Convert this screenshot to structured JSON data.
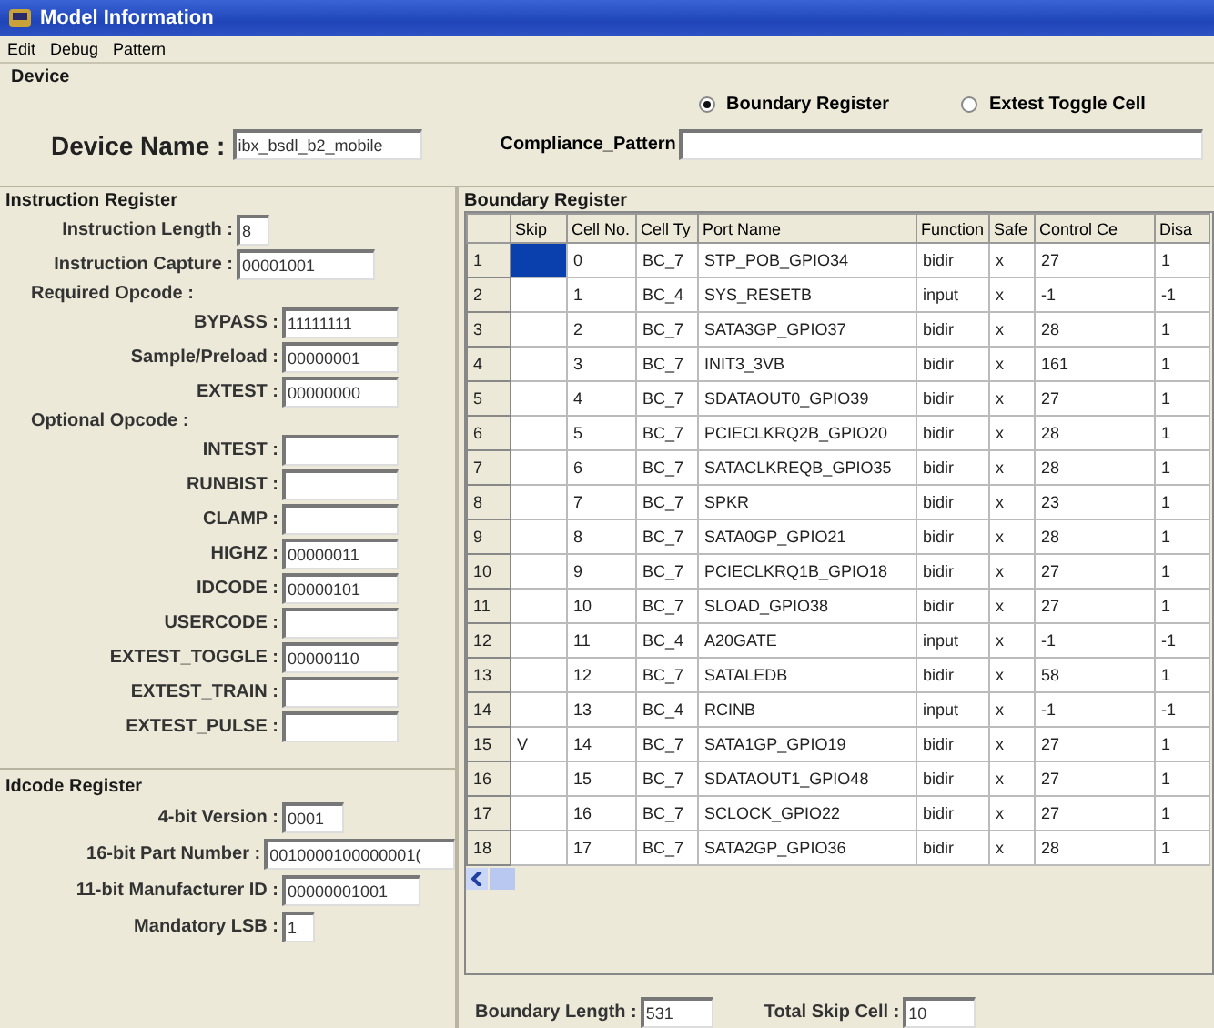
{
  "window": {
    "title": "Model Information"
  },
  "menu": [
    "Edit",
    "Debug",
    "Pattern"
  ],
  "device": {
    "title": "Device",
    "radios": [
      {
        "label": "Boundary Register",
        "selected": true
      },
      {
        "label": "Extest Toggle Cell",
        "selected": false
      }
    ],
    "name_label": "Device Name :",
    "name_value": "ibx_bsdl_b2_mobile",
    "pattern_label": "Compliance_Pattern"
  },
  "instruction_register": {
    "title": "Instruction Register",
    "items": [
      {
        "kind": "field",
        "label": "Instruction Length :",
        "value": "8"
      },
      {
        "kind": "field",
        "label": "Instruction Capture :",
        "value": "00001001"
      },
      {
        "kind": "heading",
        "label": "Required Opcode :"
      },
      {
        "kind": "opcode",
        "label": "BYPASS :",
        "value": "11111111"
      },
      {
        "kind": "opcode",
        "label": "Sample/Preload :",
        "value": "00000001"
      },
      {
        "kind": "opcode",
        "label": "EXTEST :",
        "value": "00000000"
      },
      {
        "kind": "heading",
        "label": "Optional Opcode :"
      },
      {
        "kind": "opcode",
        "label": "INTEST :"
      },
      {
        "kind": "opcode",
        "label": "RUNBIST :"
      },
      {
        "kind": "opcode",
        "label": "CLAMP :"
      },
      {
        "kind": "opcode",
        "label": "HIGHZ :",
        "value": "00000011"
      },
      {
        "kind": "opcode",
        "label": "IDCODE :",
        "value": "00000101"
      },
      {
        "kind": "opcode",
        "label": "USERCODE :"
      },
      {
        "kind": "opcode",
        "label": "EXTEST_TOGGLE :",
        "value": "00000110"
      },
      {
        "kind": "opcode",
        "label": "EXTEST_TRAIN :"
      },
      {
        "kind": "opcode",
        "label": "EXTEST_PULSE :"
      }
    ]
  },
  "idcode_register": {
    "title": "Idcode Register",
    "items": [
      {
        "label": "4-bit Version :",
        "value": "0001"
      },
      {
        "label": "16-bit Part Number :",
        "value": "0010000100000001("
      },
      {
        "label": "11-bit Manufacturer ID :",
        "value": "00000001001"
      },
      {
        "label": "Mandatory LSB :",
        "value": "1"
      }
    ]
  },
  "boundary_register": {
    "title": "Boundary Register",
    "columns": [
      "Skip",
      "Cell No.",
      "Cell Ty",
      "Port Name",
      "Function",
      "Safe",
      "Control Ce",
      "Disa"
    ],
    "rows": [
      {
        "header": "1",
        "selected": true,
        "cells": [
          "",
          "0",
          "BC_7",
          "STP_POB_GPIO34",
          "bidir",
          "x",
          "27",
          "1"
        ]
      },
      {
        "header": "2",
        "selected": false,
        "cells": [
          "",
          "1",
          "BC_4",
          "SYS_RESETB",
          "input",
          "x",
          "-1",
          "-1"
        ]
      },
      {
        "header": "3",
        "selected": false,
        "cells": [
          "",
          "2",
          "BC_7",
          "SATA3GP_GPIO37",
          "bidir",
          "x",
          "28",
          "1"
        ]
      },
      {
        "header": "4",
        "selected": false,
        "cells": [
          "",
          "3",
          "BC_7",
          "INIT3_3VB",
          "bidir",
          "x",
          "161",
          "1"
        ]
      },
      {
        "header": "5",
        "selected": false,
        "cells": [
          "",
          "4",
          "BC_7",
          "SDATAOUT0_GPIO39",
          "bidir",
          "x",
          "27",
          "1"
        ]
      },
      {
        "header": "6",
        "selected": false,
        "cells": [
          "",
          "5",
          "BC_7",
          "PCIECLKRQ2B_GPIO20",
          "bidir",
          "x",
          "28",
          "1"
        ]
      },
      {
        "header": "7",
        "selected": false,
        "cells": [
          "",
          "6",
          "BC_7",
          "SATACLKREQB_GPIO35",
          "bidir",
          "x",
          "28",
          "1"
        ]
      },
      {
        "header": "8",
        "selected": false,
        "cells": [
          "",
          "7",
          "BC_7",
          "SPKR",
          "bidir",
          "x",
          "23",
          "1"
        ]
      },
      {
        "header": "9",
        "selected": false,
        "cells": [
          "",
          "8",
          "BC_7",
          "SATA0GP_GPIO21",
          "bidir",
          "x",
          "28",
          "1"
        ]
      },
      {
        "header": "10",
        "selected": false,
        "cells": [
          "",
          "9",
          "BC_7",
          "PCIECLKRQ1B_GPIO18",
          "bidir",
          "x",
          "27",
          "1"
        ]
      },
      {
        "header": "11",
        "selected": false,
        "cells": [
          "",
          "10",
          "BC_7",
          "SLOAD_GPIO38",
          "bidir",
          "x",
          "27",
          "1"
        ]
      },
      {
        "header": "12",
        "selected": false,
        "cells": [
          "",
          "11",
          "BC_4",
          "A20GATE",
          "input",
          "x",
          "-1",
          "-1"
        ]
      },
      {
        "header": "13",
        "selected": false,
        "cells": [
          "",
          "12",
          "BC_7",
          "SATALEDB",
          "bidir",
          "x",
          "58",
          "1"
        ]
      },
      {
        "header": "14",
        "selected": false,
        "cells": [
          "",
          "13",
          "BC_4",
          "RCINB",
          "input",
          "x",
          "-1",
          "-1"
        ]
      },
      {
        "header": "15",
        "selected": false,
        "cells": [
          "V",
          "14",
          "BC_7",
          "SATA1GP_GPIO19",
          "bidir",
          "x",
          "27",
          "1"
        ]
      },
      {
        "header": "16",
        "selected": false,
        "cells": [
          "",
          "15",
          "BC_7",
          "SDATAOUT1_GPIO48",
          "bidir",
          "x",
          "27",
          "1"
        ]
      },
      {
        "header": "17",
        "selected": false,
        "cells": [
          "",
          "16",
          "BC_7",
          "SCLOCK_GPIO22",
          "bidir",
          "x",
          "27",
          "1"
        ]
      },
      {
        "header": "18",
        "selected": false,
        "cells": [
          "",
          "17",
          "BC_7",
          "SATA2GP_GPIO36",
          "bidir",
          "x",
          "28",
          "1"
        ]
      }
    ],
    "length_label": "Boundary Length :",
    "length_value": "531",
    "skip_label": "Total Skip Cell :",
    "skip_value": "10"
  }
}
